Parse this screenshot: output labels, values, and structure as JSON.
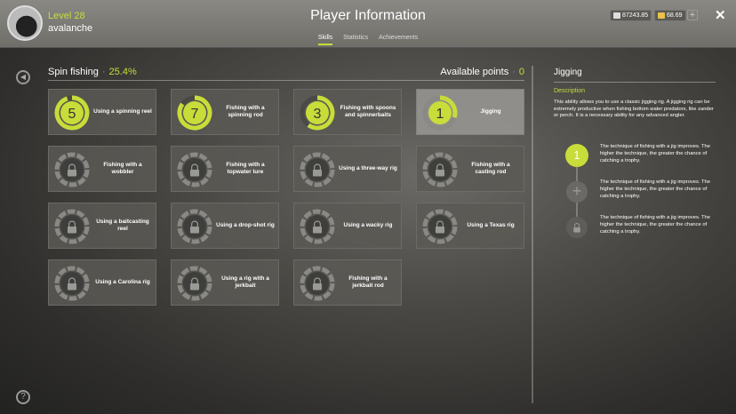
{
  "header": {
    "title": "Player Information",
    "level": "Level 28",
    "username": "avalanche",
    "silver": "87243.85",
    "gold": "68.69",
    "plus_label": "+",
    "close_label": "✕",
    "tabs": [
      {
        "label": "Skills",
        "active": true
      },
      {
        "label": "Statistics",
        "active": false
      },
      {
        "label": "Achievements",
        "active": false
      }
    ]
  },
  "skills": {
    "category": "Spin fishing",
    "separator": "·",
    "percent": "25.4%",
    "available_label": "Available points",
    "available_points": "0",
    "tiles": [
      {
        "label": "Using a spinning reel",
        "level": "5",
        "locked": false,
        "progress": 0.95,
        "selected": false
      },
      {
        "label": "Fishing with a spinning rod",
        "level": "7",
        "locked": false,
        "progress": 0.85,
        "selected": false
      },
      {
        "label": "Fishing with spoons and spinnerbaits",
        "level": "3",
        "locked": false,
        "progress": 0.6,
        "selected": false
      },
      {
        "label": "Jigging",
        "level": "1",
        "locked": false,
        "progress": 0.3,
        "selected": true
      },
      {
        "label": "Fishing with a wobbler",
        "level": "",
        "locked": true,
        "progress": 0,
        "selected": false
      },
      {
        "label": "Fishing with a topwater lure",
        "level": "",
        "locked": true,
        "progress": 0,
        "selected": false
      },
      {
        "label": "Using a three-way rig",
        "level": "",
        "locked": true,
        "progress": 0,
        "selected": false
      },
      {
        "label": "Fishing with a casting rod",
        "level": "",
        "locked": true,
        "progress": 0,
        "selected": false
      },
      {
        "label": "Using a baitcasting reel",
        "level": "",
        "locked": true,
        "progress": 0,
        "selected": false
      },
      {
        "label": "Using a drop-shot rig",
        "level": "",
        "locked": true,
        "progress": 0,
        "selected": false
      },
      {
        "label": "Using a wacky rig",
        "level": "",
        "locked": true,
        "progress": 0,
        "selected": false
      },
      {
        "label": "Using a Texas rig",
        "level": "",
        "locked": true,
        "progress": 0,
        "selected": false
      },
      {
        "label": "Using a Carolina rig",
        "level": "",
        "locked": true,
        "progress": 0,
        "selected": false
      },
      {
        "label": "Using a rig with a jerkbait",
        "level": "",
        "locked": true,
        "progress": 0,
        "selected": false
      },
      {
        "label": "Fishing with a jerkbait rod",
        "level": "",
        "locked": true,
        "progress": 0,
        "selected": false
      }
    ]
  },
  "detail": {
    "title": "Jigging",
    "description_heading": "Description",
    "description": "This ability allows you to use a classic jigging rig. A jigging rig can be extremely productive when fishing bottom water predators, like zander or perch. It is a necessary ability for any advanced angler.",
    "techniques": [
      {
        "state": "active",
        "label": "1",
        "text": "The technique of fishing with a jig improves. The higher the technique, the greater the chance of catching a trophy."
      },
      {
        "state": "plus",
        "label": "+",
        "text": "The technique of fishing with a jig improves. The higher the technique, the greater the chance of catching a trophy."
      },
      {
        "state": "locked",
        "label": "",
        "text": "The technique of fishing with a jig improves. The higher the technique, the greater the chance of catching a trophy."
      }
    ]
  },
  "icons": {
    "back": "back-arrow-icon",
    "help": "help-icon",
    "lock": "lock-icon",
    "silver": "silver-coin-icon",
    "gold": "gold-coin-icon"
  },
  "colors": {
    "accent": "#c8dc3a",
    "locked_ring": "#8a8985",
    "empty_ring": "#4a4946"
  }
}
